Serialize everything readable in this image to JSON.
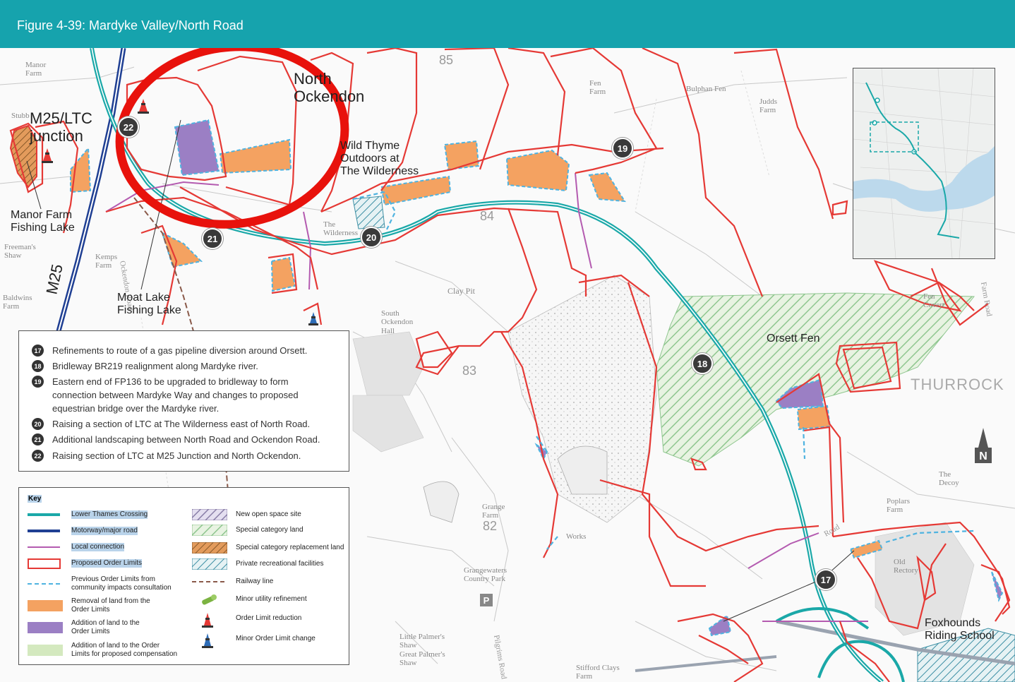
{
  "header": {
    "title": "Figure 4-39: Mardyke Valley/North Road"
  },
  "map_labels": {
    "north_ockendon": "North\nOckendon",
    "m25_ltc_junction": "M25/LTC\njunction",
    "wild_thyme": "Wild Thyme\nOutdoors at\nThe Wilderness",
    "manor_farm_fishing": "Manor Farm\nFishing Lake",
    "moat_lake": "Moat Lake\nFishing Lake",
    "m25": "M25",
    "orsett_fen": "Orsett Fen",
    "thurrock": "THURROCK",
    "foxhounds": "Foxhounds\nRiding School",
    "clay_pit": "Clay Pit",
    "south_ockendon_hall": "South\nOckendon\nHall",
    "grange_farm": "Grange\nFarm",
    "grangewaters": "Grangewaters\nCountry Park",
    "bulphan_fen": "Bulphan Fen",
    "fen_farm": "Fen\nFarm",
    "judds_farm": "Judds\nFarm",
    "kemps_farm": "Kemps\nFarm",
    "manor_farm": "Manor\nFarm",
    "stubbers": "Stubb",
    "freemans_shaw": "Freeman's\nShaw",
    "baldwins_farm": "Baldwins\nFarm",
    "fen_covert": "Fen\nCovert",
    "poplars_farm": "Poplars\nFarm",
    "the_decoy": "The\nDecoy",
    "old_rectory": "Old\nRectory",
    "little_palmers": "Little Palmer's\nShaw\nGreat Palmer's\nShaw",
    "stifford_clays": "Stifford Clays\nFarm",
    "the_wilderness": "The\nWilderness",
    "works": "Works",
    "grid_85": "85",
    "grid_84": "84",
    "grid_83": "83",
    "grid_82": "82",
    "p_symbol": "P"
  },
  "markers": [
    "17",
    "18",
    "19",
    "20",
    "21",
    "22"
  ],
  "notes": [
    {
      "num": "17",
      "text": "Refinements to route of a gas pipeline diversion around Orsett."
    },
    {
      "num": "18",
      "text": "Bridleway BR219 realignment along Mardyke river."
    },
    {
      "num": "19",
      "text": "Eastern end of FP136 to be upgraded to bridleway to form connection between Mardyke Way and changes to proposed equestrian bridge over the Mardyke river."
    },
    {
      "num": "20",
      "text": "Raising a section of LTC at The Wilderness east of North Road."
    },
    {
      "num": "21",
      "text": "Additional landscaping between North Road and Ockendon Road."
    },
    {
      "num": "22",
      "text": "Raising section of LTC at M25 Junction and North Ockendon."
    }
  ],
  "key": {
    "title": "Key",
    "left": [
      {
        "label": "Lower Thames Crossing",
        "symbol": "teal-double-line"
      },
      {
        "label": "Motorway/major road",
        "symbol": "blue-double-line"
      },
      {
        "label": "Local connection",
        "symbol": "purple-line"
      },
      {
        "label": "Proposed Order Limits",
        "symbol": "red-outline-box"
      },
      {
        "label": "Previous Order Limits from\ncommunity impacts consultation",
        "symbol": "blue-dashed-line"
      },
      {
        "label": "Removal of land from the\nOrder Limits",
        "symbol": "orange-fill"
      },
      {
        "label": "Addition of land to the\nOrder Limits",
        "symbol": "purple-fill"
      },
      {
        "label": "Addition of land to the Order\nLimits for proposed compensation",
        "symbol": "light-green-fill"
      }
    ],
    "right": [
      {
        "label": "New open space site",
        "symbol": "purple-hatch"
      },
      {
        "label": "Special category land",
        "symbol": "green-hatch"
      },
      {
        "label": "Special category replacement land",
        "symbol": "brown-hatch"
      },
      {
        "label": "Private recreational facilities",
        "symbol": "teal-hatch"
      },
      {
        "label": "Railway line",
        "symbol": "railway-dashed"
      },
      {
        "label": "Minor utility refinement",
        "symbol": "utility-icon"
      },
      {
        "label": "Order Limit reduction",
        "symbol": "red-cone-icon"
      },
      {
        "label": "Minor Order Limit change",
        "symbol": "blue-cone-icon"
      }
    ]
  },
  "compass": {
    "letter": "N"
  },
  "colors": {
    "header": "#16a3ad",
    "ltc": "#1aa8a8",
    "order_limits": "#e53935",
    "removal": "#f4a261",
    "addition": "#9b7fc4",
    "special_land": "#8fc68f"
  }
}
